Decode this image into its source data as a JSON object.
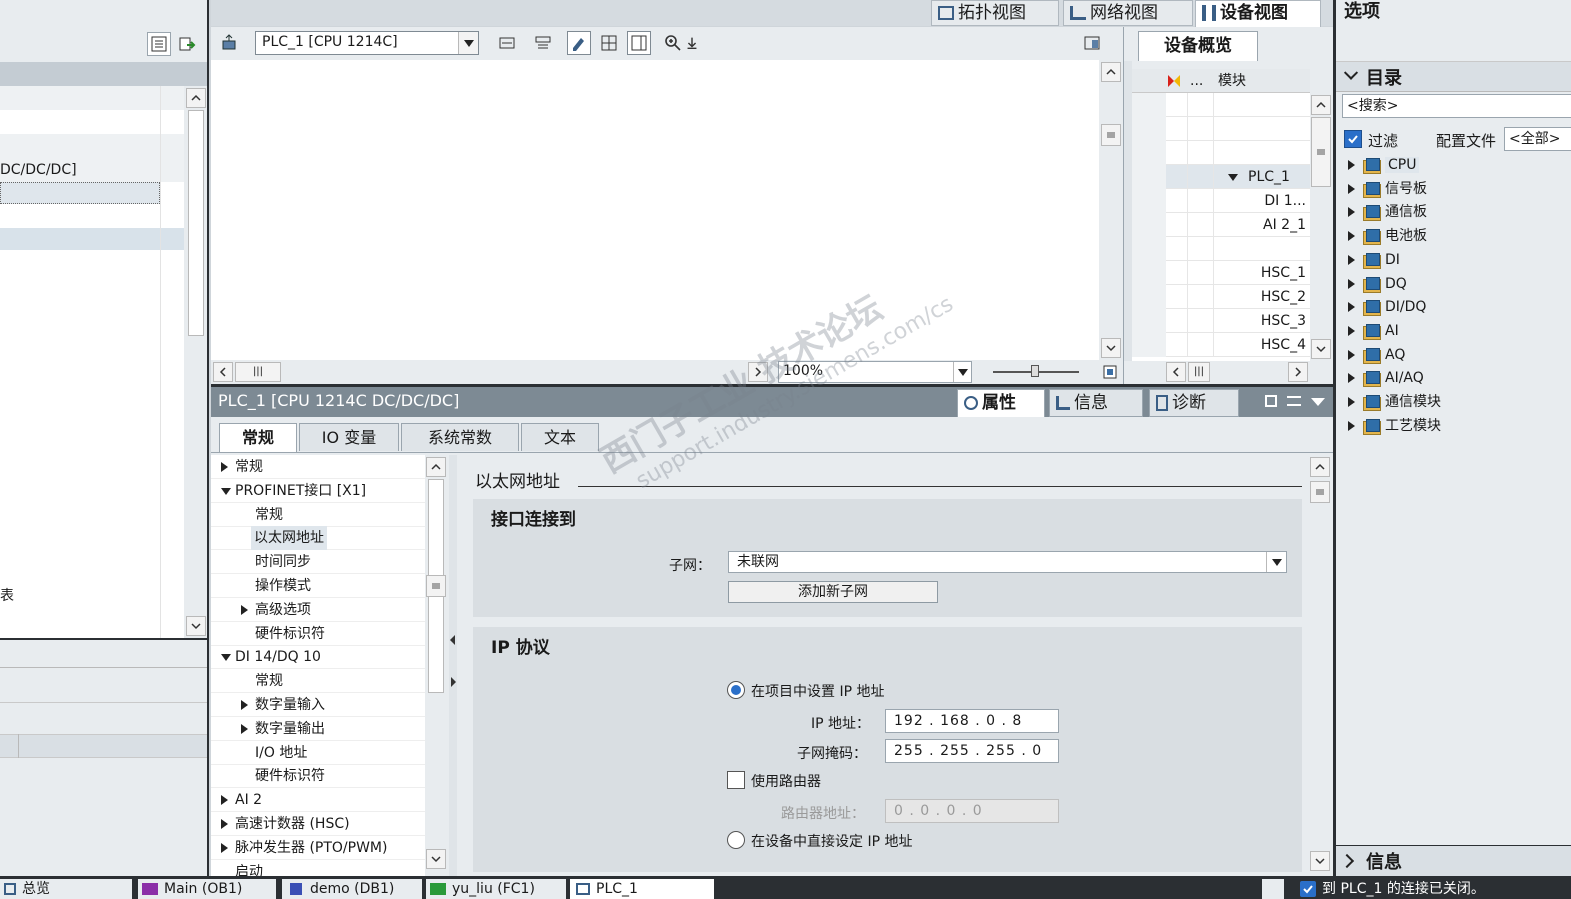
{
  "top_tabs": {
    "topology": "拓扑视图",
    "network": "网络视图",
    "device": "设备视图"
  },
  "device_selector": "PLC_1 [CPU 1214C]",
  "zoom": "100%",
  "left_panel": {
    "row_text_1": "DC/DC/DC]",
    "row_text_2": "表"
  },
  "overview": {
    "tab": "设备概览",
    "col_more": "...",
    "col_module": "模块",
    "rows": [
      "",
      "",
      "",
      "PLC_1",
      "DI 1...",
      "AI 2_1",
      "",
      "HSC_1",
      "HSC_2",
      "HSC_3",
      "HSC_4"
    ]
  },
  "options": {
    "title": "选项",
    "catalog": "目录",
    "search_placeholder": "<搜索>",
    "filter": "过滤",
    "config_label": "配置文件",
    "config_value": "<全部>",
    "items": [
      "CPU",
      "信号板",
      "通信板",
      "电池板",
      "DI",
      "DQ",
      "DI/DQ",
      "AI",
      "AQ",
      "AI/AQ",
      "通信模块",
      "工艺模块"
    ],
    "info": "信息"
  },
  "inspector": {
    "title": "PLC_1 [CPU 1214C DC/DC/DC]",
    "tabs_right": {
      "properties": "属性",
      "info": "信息",
      "diagnostics": "诊断"
    },
    "tabs": [
      "常规",
      "IO 变量",
      "系统常数",
      "文本"
    ],
    "nav": [
      {
        "label": "常规",
        "caret": "r",
        "indent": 0
      },
      {
        "label": "PROFINET接口 [X1]",
        "caret": "d",
        "indent": 0
      },
      {
        "label": "常规",
        "caret": "",
        "indent": 1
      },
      {
        "label": "以太网地址",
        "caret": "",
        "indent": 1,
        "selected": true
      },
      {
        "label": "时间同步",
        "caret": "",
        "indent": 1
      },
      {
        "label": "操作模式",
        "caret": "",
        "indent": 1
      },
      {
        "label": "高级选项",
        "caret": "r",
        "indent": 1
      },
      {
        "label": "硬件标识符",
        "caret": "",
        "indent": 1
      },
      {
        "label": "DI 14/DQ 10",
        "caret": "d",
        "indent": 0
      },
      {
        "label": "常规",
        "caret": "",
        "indent": 1
      },
      {
        "label": "数字量输入",
        "caret": "r",
        "indent": 1
      },
      {
        "label": "数字量输出",
        "caret": "r",
        "indent": 1
      },
      {
        "label": "I/O 地址",
        "caret": "",
        "indent": 1
      },
      {
        "label": "硬件标识符",
        "caret": "",
        "indent": 1
      },
      {
        "label": "AI 2",
        "caret": "r",
        "indent": 0
      },
      {
        "label": "高速计数器 (HSC)",
        "caret": "r",
        "indent": 0
      },
      {
        "label": "脉冲发生器 (PTO/PWM)",
        "caret": "r",
        "indent": 0
      },
      {
        "label": "启动",
        "caret": "",
        "indent": 0
      }
    ],
    "section_title": "以太网地址",
    "interface_title": "接口连接到",
    "subnet_label": "子网：",
    "subnet_value": "未联网",
    "add_subnet": "添加新子网",
    "ip_title": "IP 协议",
    "radio_project": "在项目中设置 IP 地址",
    "ip_label": "IP 地址：",
    "ip_value": "192 . 168 . 0   . 8",
    "mask_label": "子网掩码：",
    "mask_value": "255 . 255 . 255 . 0",
    "router_check": "使用路由器",
    "router_label": "路由器地址：",
    "router_value": "0   . 0   . 0   . 0",
    "radio_device": "在设备中直接设定 IP 地址"
  },
  "watermark": {
    "line1": "西门子工业  技术论坛",
    "line2": "support.industry.siemens.com/cs"
  },
  "taskbar": {
    "overview": "总览",
    "items": [
      "Main (OB1)",
      "demo (DB1)",
      "yu_liu (FC1)",
      "PLC_1"
    ],
    "status": "到 PLC_1 的连接已关闭。"
  }
}
